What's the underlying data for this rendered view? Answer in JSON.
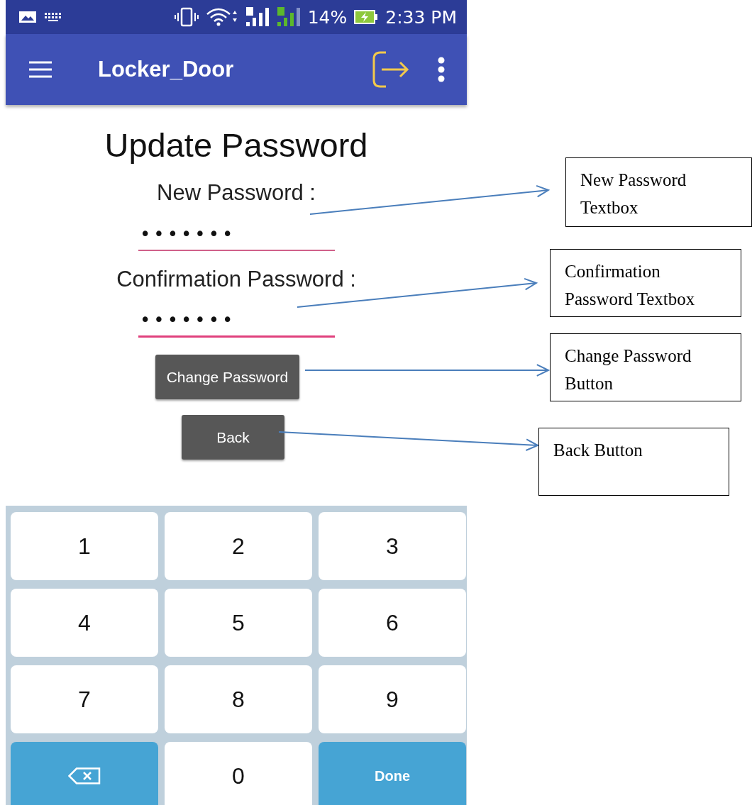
{
  "status_bar": {
    "battery": "14%",
    "time": "2:33 PM"
  },
  "app_bar": {
    "title": "Locker_Door"
  },
  "form": {
    "title": "Update Password",
    "fields": [
      {
        "label": "New Password :",
        "value": "•••••••"
      },
      {
        "label": "Confirmation Password :",
        "value": "•••••••"
      }
    ],
    "buttons": [
      "Change Password",
      "Back"
    ]
  },
  "keyboard": {
    "keys": [
      {
        "kind": "digit",
        "label": "1"
      },
      {
        "kind": "digit",
        "label": "2"
      },
      {
        "kind": "digit",
        "label": "3"
      },
      {
        "kind": "digit",
        "label": "4"
      },
      {
        "kind": "digit",
        "label": "5"
      },
      {
        "kind": "digit",
        "label": "6"
      },
      {
        "kind": "digit",
        "label": "7"
      },
      {
        "kind": "digit",
        "label": "8"
      },
      {
        "kind": "digit",
        "label": "9"
      },
      {
        "kind": "backspace"
      },
      {
        "kind": "digit",
        "label": "0"
      },
      {
        "kind": "done",
        "label": "Done"
      }
    ]
  },
  "annotations": [
    "New Password Textbox",
    "Confirmation Password Textbox",
    "Change Password Button",
    "Back Button"
  ]
}
